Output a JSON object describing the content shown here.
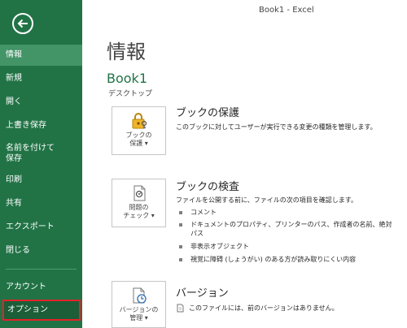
{
  "window_title": "Book1 - Excel",
  "sidebar": {
    "items": [
      {
        "label": "情報"
      },
      {
        "label": "新規"
      },
      {
        "label": "開く"
      },
      {
        "label": "上書き保存"
      },
      {
        "label": "名前を付けて\n保存"
      },
      {
        "label": "印刷"
      },
      {
        "label": "共有"
      },
      {
        "label": "エクスポート"
      },
      {
        "label": "閉じる"
      },
      {
        "label": "アカウント"
      },
      {
        "label": "オプション"
      }
    ]
  },
  "main": {
    "title": "情報",
    "doc_name": "Book1",
    "doc_location": "デスクトップ",
    "protect": {
      "button_label": "ブックの\n保護 ▾",
      "title": "ブックの保護",
      "description": "このブックに対してユーザーが実行できる変更の種類を管理します。"
    },
    "inspect": {
      "button_label": "問題の\nチェック ▾",
      "title": "ブックの検査",
      "description": "ファイルを公開する前に、ファイルの次の項目を確認します。",
      "bullets": [
        "コメント",
        "ドキュメントのプロパティ、プリンターのパス、作成者の名前、絶対パス",
        "非表示オブジェクト",
        "視覚に障碍 (しょうがい) のある方が読み取りにくい内容"
      ]
    },
    "versions": {
      "button_label": "バージョンの\n管理 ▾",
      "title": "バージョン",
      "note": "このファイルには、前のバージョンはありません。"
    }
  },
  "colors": {
    "sidebar_bg": "#217346",
    "sidebar_active": "#439467",
    "highlight_border": "#e8202a",
    "accent_green": "#217346"
  }
}
